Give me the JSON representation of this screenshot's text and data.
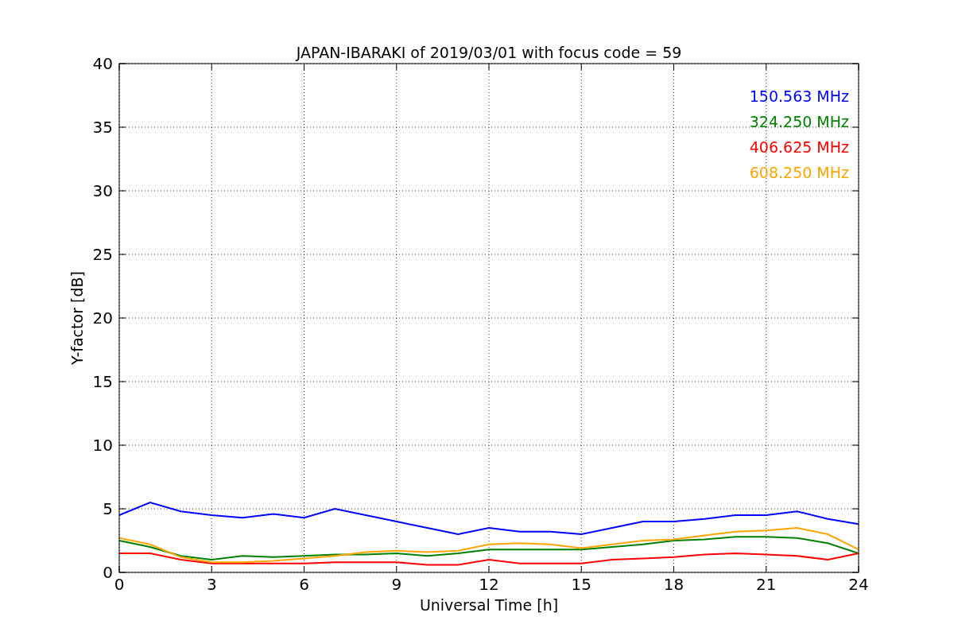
{
  "chart_data": {
    "type": "line",
    "title": "JAPAN-IBARAKI of 2019/03/01 with focus code = 59",
    "xlabel": "Universal Time [h]",
    "ylabel": "Y-factor [dB]",
    "x": [
      0,
      1,
      2,
      3,
      4,
      5,
      6,
      7,
      8,
      9,
      10,
      11,
      12,
      13,
      14,
      15,
      16,
      17,
      18,
      19,
      20,
      21,
      22,
      23,
      24
    ],
    "series": [
      {
        "name": "150.563 MHz",
        "color": "#0000ff",
        "values": [
          4.5,
          5.5,
          4.8,
          4.5,
          4.3,
          4.6,
          4.3,
          5,
          4.5,
          4,
          3.5,
          3,
          3.5,
          3.2,
          3.2,
          3,
          3.5,
          4,
          4,
          4.2,
          4.5,
          4.5,
          4.8,
          4.2,
          3.8
        ]
      },
      {
        "name": "324.250 MHz",
        "color": "#008000",
        "values": [
          2.5,
          2,
          1.3,
          1,
          1.3,
          1.2,
          1.3,
          1.4,
          1.4,
          1.5,
          1.3,
          1.5,
          1.8,
          1.8,
          1.8,
          1.8,
          2,
          2.2,
          2.5,
          2.6,
          2.8,
          2.8,
          2.7,
          2.3,
          1.5
        ]
      },
      {
        "name": "406.625 MHz",
        "color": "#ff0000",
        "values": [
          1.5,
          1.5,
          1,
          0.7,
          0.7,
          0.7,
          0.7,
          0.8,
          0.8,
          0.8,
          0.6,
          0.6,
          1,
          0.7,
          0.7,
          0.7,
          1,
          1.1,
          1.2,
          1.4,
          1.5,
          1.4,
          1.3,
          1,
          1.5
        ]
      },
      {
        "name": "608.250 MHz",
        "color": "#ffa500",
        "values": [
          2.7,
          2.2,
          1.2,
          0.8,
          0.8,
          0.9,
          1.1,
          1.3,
          1.6,
          1.7,
          1.6,
          1.7,
          2.2,
          2.3,
          2.2,
          1.9,
          2.2,
          2.5,
          2.6,
          2.9,
          3.2,
          3.3,
          3.5,
          3,
          1.8
        ]
      }
    ],
    "grid": true,
    "xlim": [
      0,
      24
    ],
    "ylim": [
      0,
      40
    ],
    "xticks": [
      0,
      3,
      6,
      9,
      12,
      15,
      18,
      21,
      24
    ],
    "yticks": [
      0,
      5,
      10,
      15,
      20,
      25,
      30,
      35,
      40
    ]
  }
}
